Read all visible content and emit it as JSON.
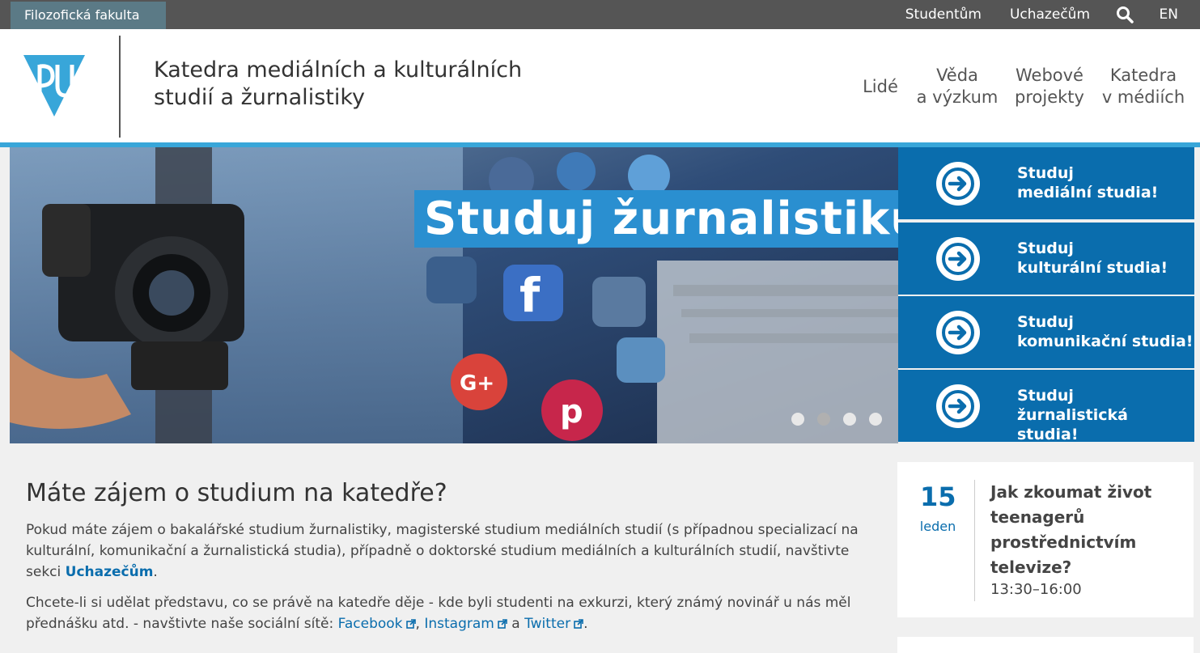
{
  "topbar": {
    "faculty": "Filozofická fakulta",
    "links": [
      "Studentům",
      "Uchazečům"
    ],
    "lang": "EN",
    "search_icon": "search-icon"
  },
  "header": {
    "title_line1": "Katedra mediálních a kulturálních",
    "title_line2": "studií a žurnalistiky",
    "nav": [
      {
        "line1": "Lidé",
        "line2": ""
      },
      {
        "line1": "Věda",
        "line2": "a výzkum"
      },
      {
        "line1": "Webové",
        "line2": "projekty"
      },
      {
        "line1": "Katedra",
        "line2": "v médiích"
      }
    ]
  },
  "hero": {
    "banner": "Studuj žurnalistiku!",
    "slides": 4,
    "active_slide": 2
  },
  "study": [
    {
      "line1": "Studuj",
      "line2": "mediální studia!"
    },
    {
      "line1": "Studuj",
      "line2": "kulturální studia!"
    },
    {
      "line1": "Studuj",
      "line2": "komunikační studia!"
    },
    {
      "line1": "Studuj",
      "line2": "žurnalistická studia!"
    }
  ],
  "main": {
    "heading": "Máte zájem o studium na katedře?",
    "p1_text": "Pokud máte zájem o bakalářské studium žurnalistiky, magisterské studium mediálních studií (s případnou specializací na kulturální, komunikační a žurnalistická studia), případně o doktorské studium mediálních a kulturálních studií, navštivte sekci ",
    "p1_link": "Uchazečům",
    "p1_end": ".",
    "p2_text": "Chcete-li si udělat představu, co se právě na katedře děje - kde byli studenti na exkurzi, který známý novinář u nás měl přednášku atd. - navštivte naše sociální sítě: ",
    "p2_links": [
      "Facebook",
      "Instagram",
      "Twitter"
    ],
    "p2_sep1": ", ",
    "p2_sep2": " a ",
    "p2_end": "."
  },
  "event": {
    "day": "15",
    "month": "leden",
    "title": "Jak zkoumat život teenagerů prostřednictvím televize?",
    "time": "13:30–16:00"
  },
  "colors": {
    "primary": "#0a6dad",
    "accent": "#38a6d9",
    "topbar": "#555555"
  }
}
